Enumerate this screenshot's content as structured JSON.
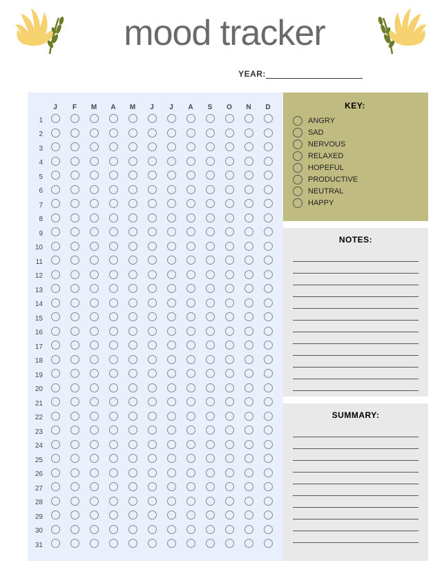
{
  "title": "mood tracker",
  "year_label": "YEAR:",
  "months": [
    "J",
    "F",
    "M",
    "A",
    "M",
    "J",
    "J",
    "A",
    "S",
    "O",
    "N",
    "D"
  ],
  "days": [
    1,
    2,
    3,
    4,
    5,
    6,
    7,
    8,
    9,
    10,
    11,
    12,
    13,
    14,
    15,
    16,
    17,
    18,
    19,
    20,
    21,
    22,
    23,
    24,
    25,
    26,
    27,
    28,
    29,
    30,
    31
  ],
  "key": {
    "title": "KEY:",
    "items": [
      "ANGRY",
      "SAD",
      "NERVOUS",
      "RELAXED",
      "HOPEFUL",
      "PRODUCTIVE",
      "NEUTRAL",
      "HAPPY"
    ]
  },
  "notes": {
    "title": "NOTES:",
    "lines": 12
  },
  "summary": {
    "title": "SUMMARY:",
    "lines": 10
  },
  "colors": {
    "grid_bg": "#eaf0fb",
    "key_bg": "#c0bb80",
    "side_bg": "#e9e9e9",
    "title": "#6a6a6a",
    "leaf_petal": "#f5d170",
    "leaf_stem": "#6b7d26"
  }
}
